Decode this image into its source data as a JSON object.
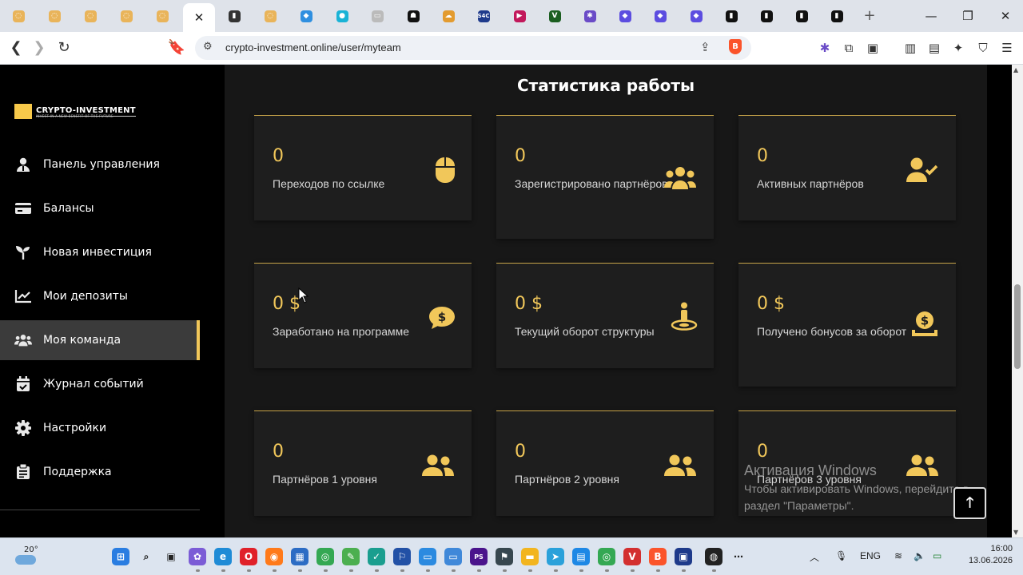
{
  "browser": {
    "url": "crypto-investment.online/user/myteam",
    "tabs": [
      {
        "icon": "orange-coin-icon",
        "color": "#e9b45a",
        "glyph": "◌"
      },
      {
        "icon": "orange-coin-icon",
        "color": "#e9b45a",
        "glyph": "◌"
      },
      {
        "icon": "orange-coin-icon",
        "color": "#e9b45a",
        "glyph": "◌"
      },
      {
        "icon": "orange-coin-icon",
        "color": "#e9b45a",
        "glyph": "◌"
      },
      {
        "icon": "orange-coin-icon",
        "color": "#e9b45a",
        "glyph": "◌"
      },
      {
        "icon": "close-icon",
        "color": "",
        "glyph": "✕",
        "active": true
      },
      {
        "icon": "bank-icon",
        "color": "#333333",
        "glyph": "▮"
      },
      {
        "icon": "orange-coin-icon",
        "color": "#e9b45a",
        "glyph": "◌"
      },
      {
        "icon": "blue-cube-icon",
        "color": "#2f8fe0",
        "glyph": "◆"
      },
      {
        "icon": "cyan-coin-icon",
        "color": "#19b3d6",
        "glyph": "●"
      },
      {
        "icon": "card-icon",
        "color": "#bbbbbb",
        "glyph": "▭"
      },
      {
        "icon": "ghost-icon",
        "color": "#111111",
        "glyph": "☗"
      },
      {
        "icon": "cloud-icon",
        "color": "#e39b2f",
        "glyph": "☁"
      },
      {
        "icon": "s4c-icon",
        "color": "#1f3b8c",
        "glyph": "S4C"
      },
      {
        "icon": "play-icon",
        "color": "#c2185b",
        "glyph": "▶"
      },
      {
        "icon": "v-icon",
        "color": "#1b5e20",
        "glyph": "V"
      },
      {
        "icon": "octopus-icon",
        "color": "#6a4bc7",
        "glyph": "✱"
      },
      {
        "icon": "diamond-icon",
        "color": "#5c4de0",
        "glyph": "◆"
      },
      {
        "icon": "diamond-icon",
        "color": "#5c4de0",
        "glyph": "◆"
      },
      {
        "icon": "diamond-icon",
        "color": "#5c4de0",
        "glyph": "◆"
      },
      {
        "icon": "wallet-icon",
        "color": "#111111",
        "glyph": "▮"
      },
      {
        "icon": "wallet-icon",
        "color": "#111111",
        "glyph": "▮"
      },
      {
        "icon": "wallet-icon",
        "color": "#111111",
        "glyph": "▮"
      },
      {
        "icon": "wallet-icon",
        "color": "#111111",
        "glyph": "▮"
      }
    ],
    "new_tab_glyph": "+",
    "window_controls": [
      "—",
      "❐",
      "✕"
    ]
  },
  "sidebar": {
    "logo_text": "CRYPTO-INVESTMENT",
    "logo_sub": "INVEST IN A NEW BENEFIT OF THE FUTURE",
    "items": [
      {
        "label": "Панель управления",
        "icon": "user-icon",
        "active": false
      },
      {
        "label": "Балансы",
        "icon": "card-icon",
        "active": false
      },
      {
        "label": "Новая инвестиция",
        "icon": "seedling-icon",
        "active": false
      },
      {
        "label": "Мои депозиты",
        "icon": "chart-line-icon",
        "active": false
      },
      {
        "label": "Моя команда",
        "icon": "users-icon",
        "active": true
      },
      {
        "label": "Журнал событий",
        "icon": "calendar-check-icon",
        "active": false
      },
      {
        "label": "Настройки",
        "icon": "gear-icon",
        "active": false
      },
      {
        "label": "Поддержка",
        "icon": "support-ticket-icon",
        "active": false
      }
    ]
  },
  "main": {
    "title": "Статистика работы",
    "accent": "#f1c75a",
    "cards": [
      {
        "value": "0",
        "label": "Переходов по ссылке",
        "icon": "mouse-icon"
      },
      {
        "value": "0",
        "label": "Зарегистрировано партнёров",
        "icon": "users-group-icon"
      },
      {
        "value": "0",
        "label": "Активных партнёров",
        "icon": "user-check-icon"
      },
      {
        "value": "0 $",
        "label": "Заработано на программе",
        "icon": "dollar-bubble-icon"
      },
      {
        "value": "0 $",
        "label": "Текущий оборот структуры",
        "icon": "person-on-target-icon"
      },
      {
        "value": "0 $",
        "label": "Получено бонусов за оборот",
        "icon": "dollar-hand-icon"
      },
      {
        "value": "0",
        "label": "Партнёров 1 уровня",
        "icon": "user-friends-icon"
      },
      {
        "value": "0",
        "label": "Партнёров 2 уровня",
        "icon": "user-friends-icon"
      },
      {
        "value": "0",
        "label": "Партнёров 3 уровня",
        "icon": "user-friends-icon"
      }
    ]
  },
  "windows_activation": {
    "title": "Активация Windows",
    "text": "Чтобы активировать Windows, перейдите в раздел \"Параметры\"."
  },
  "scroll_top_glyph": "🡑",
  "taskbar": {
    "weather_temp": "20°",
    "language": "ENG",
    "time": "16:00",
    "date": "13.06.2026"
  }
}
